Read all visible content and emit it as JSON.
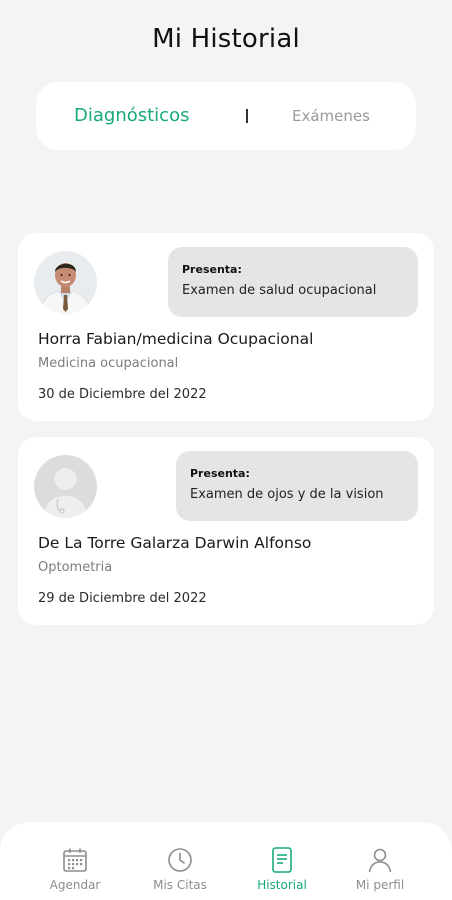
{
  "header": {
    "title": "Mi Historial"
  },
  "tabs": [
    {
      "label": "Diagnósticos",
      "active": true
    },
    {
      "label": "Exámenes",
      "active": false
    }
  ],
  "records": [
    {
      "presenta_label": "Presenta:",
      "presenta_text": "Examen de salud ocupacional",
      "doctor": "Horra Fabian/medicina Ocupacional",
      "specialty": "Medicina ocupacional",
      "date": "30 de Diciembre del 2022",
      "avatar": "doctor-photo"
    },
    {
      "presenta_label": "Presenta:",
      "presenta_text": "Examen de ojos y de la vision",
      "doctor": "De La Torre Galarza Darwin Alfonso",
      "specialty": "Optometria",
      "date": "29 de Diciembre del 2022",
      "avatar": "doctor-placeholder"
    }
  ],
  "bottom_nav": [
    {
      "label": "Agendar",
      "icon": "calendar-icon",
      "active": false
    },
    {
      "label": "Mis Citas",
      "icon": "clock-icon",
      "active": false
    },
    {
      "label": "Historial",
      "icon": "document-icon",
      "active": true
    },
    {
      "label": "Mi perfil",
      "icon": "user-icon",
      "active": false
    }
  ],
  "colors": {
    "accent": "#1aa97c",
    "background": "#f4f4f4",
    "card": "#ffffff",
    "bubble": "#e5e5e5"
  }
}
